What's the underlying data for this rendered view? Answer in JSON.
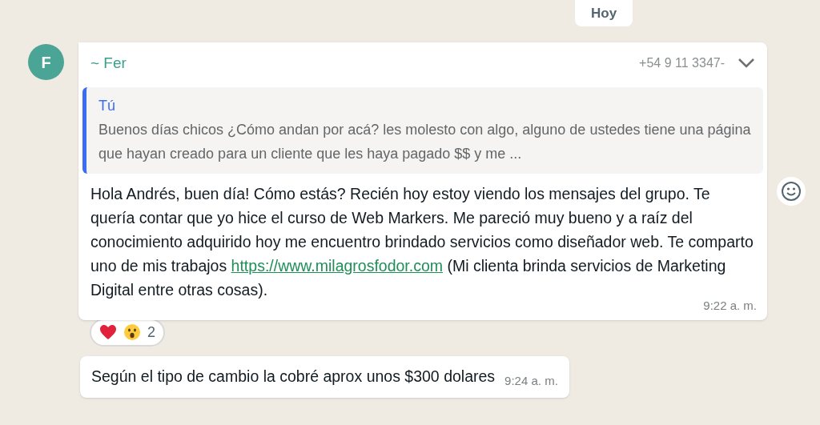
{
  "date_chip": "Hoy",
  "messages": [
    {
      "kind": "group",
      "avatar_initial": "F",
      "sender": "~ Fer",
      "phone": "+54 9 11 3347-",
      "quote": {
        "author": "Tú",
        "text": "Buenos días chicos ¿Cómo andan por acá? les molesto con algo, alguno de ustedes tiene una página que hayan creado para un cliente que les haya pagado $$ y me ..."
      },
      "body_before": "Hola Andrés, buen día! Cómo estás? Recién hoy estoy viendo los mensajes del grupo. Te quería contar que yo hice el curso de Web Markers. Me pareció muy bueno y a raíz del conocimiento adquirido hoy me encuentro brindado servicios como diseñador web. Te comparto uno de mis trabajos ",
      "link": "https://www.milagrosfodor.com",
      "body_after": " (Mi clienta brinda servicios de Marketing Digital entre otras cosas).",
      "time": "9:22 a. m.",
      "reactions": [
        {
          "kind": "heart"
        },
        {
          "kind": "surprised"
        }
      ],
      "reaction_count": "2"
    },
    {
      "kind": "continuation",
      "text": "Según el tipo de cambio la cobré aprox unos $300 dolares",
      "time": "9:24 a. m."
    }
  ]
}
